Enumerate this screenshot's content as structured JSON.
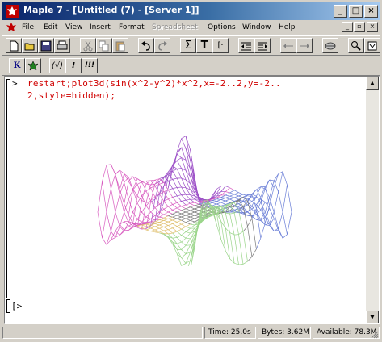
{
  "window": {
    "title": "Maple 7 - [Untitled (7) - [Server 1]]",
    "buttons": {
      "minimize": "_",
      "maximize": "□",
      "close": "×"
    }
  },
  "menu": {
    "items": [
      {
        "label": "File",
        "enabled": true
      },
      {
        "label": "Edit",
        "enabled": true
      },
      {
        "label": "View",
        "enabled": true
      },
      {
        "label": "Insert",
        "enabled": true
      },
      {
        "label": "Format",
        "enabled": true
      },
      {
        "label": "Spreadsheet",
        "enabled": false
      },
      {
        "label": "Options",
        "enabled": true
      },
      {
        "label": "Window",
        "enabled": true
      },
      {
        "label": "Help",
        "enabled": true
      }
    ],
    "mdi": {
      "minimize": "_",
      "restore": "▫",
      "close": "×"
    }
  },
  "toolbar1": {
    "sum_symbol": "Σ",
    "text_symbol": "T",
    "bracket_symbol": "[·"
  },
  "toolbar2": {
    "k_label": "K",
    "expr_label": "(√)",
    "exec_label": "!",
    "execall_label": "!!!"
  },
  "worksheet": {
    "prompt": ">",
    "input_line1": "restart;plot3d(sin(x^2-y^2)*x^2,x=-2..2,y=-2..",
    "input_line2": "2,style=hidden);",
    "empty_prompt": "[>"
  },
  "plot": {
    "type": "plot3d",
    "expression": "sin(x^2-y^2)*x^2",
    "style": "hidden",
    "colors": [
      "#9c4fc7",
      "#d85cc0",
      "#6b7fd7",
      "#9ad58a",
      "#e0c070",
      "#7a7a7a"
    ]
  },
  "statusbar": {
    "time": "Time: 25.0s",
    "bytes": "Bytes: 3.62M",
    "available": "Available: 78.3M"
  }
}
